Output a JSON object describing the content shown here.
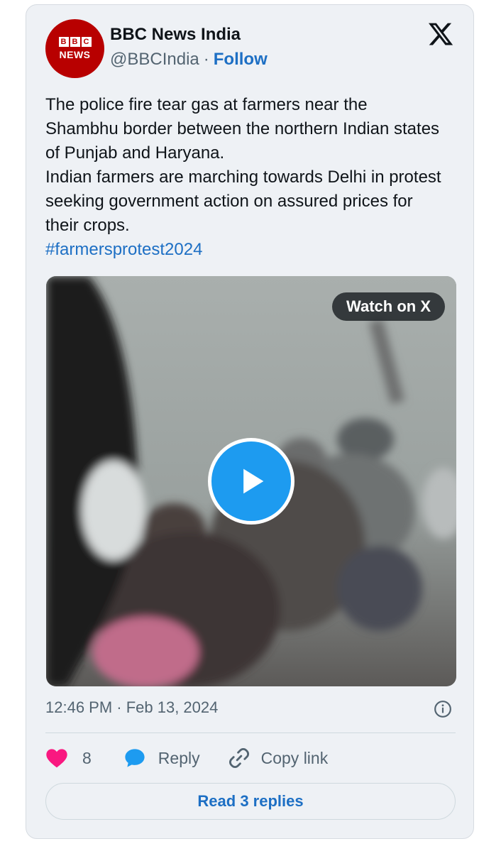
{
  "author": {
    "logo_top_letters": [
      "B",
      "B",
      "C"
    ],
    "logo_bottom_text": "NEWS",
    "name": "BBC News India",
    "handle": "@BBCIndia",
    "separator": "·",
    "follow_label": "Follow"
  },
  "tweet": {
    "paragraph_1": "The police fire tear gas at farmers near the Shambhu border between the northern Indian states of Punjab and Haryana.",
    "paragraph_2": "Indian farmers are marching towards Delhi in protest seeking government action on assured prices for their crops.",
    "hashtag": "#farmersprotest2024"
  },
  "media": {
    "watch_label": "Watch on X",
    "play_icon": "play-icon"
  },
  "meta": {
    "timestamp": "12:46 PM · Feb 13, 2024",
    "info_icon": "info-icon"
  },
  "actions": {
    "like_count": "8",
    "reply_label": "Reply",
    "copy_label": "Copy link"
  },
  "read_replies_label": "Read 3 replies",
  "colors": {
    "card_bg": "#eef1f5",
    "link": "#1d6fc4",
    "like": "#f91880",
    "reply": "#1d9bf0",
    "bbc_red": "#b80000"
  }
}
